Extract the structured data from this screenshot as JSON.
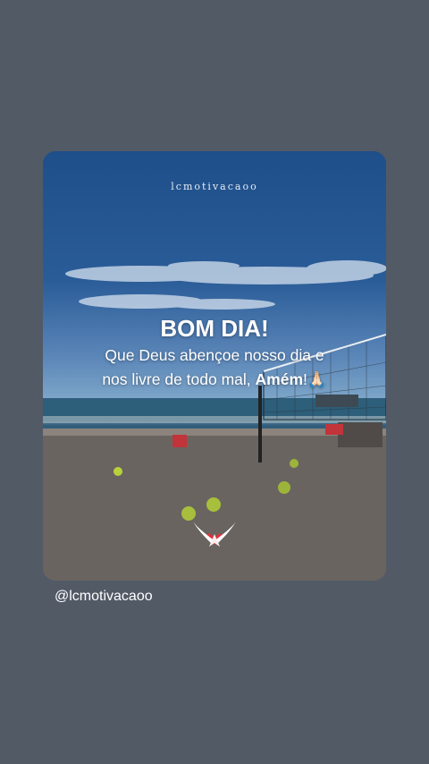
{
  "post": {
    "watermark": "lcmotivacaoo",
    "headline": "BOM DIA!",
    "line1": "Que Deus abençoe nosso dia e",
    "line2_text": "nos livre de todo mal, ",
    "line2_bold": "Amém",
    "line2_suffix": "!🙏🏻"
  },
  "footer": {
    "handle": "@lcmotivacaoo"
  },
  "colors": {
    "background": "#525a66",
    "text": "#ffffff",
    "logo_red": "#d9333f"
  },
  "icons": {
    "logo": "winged-heart-logo"
  }
}
